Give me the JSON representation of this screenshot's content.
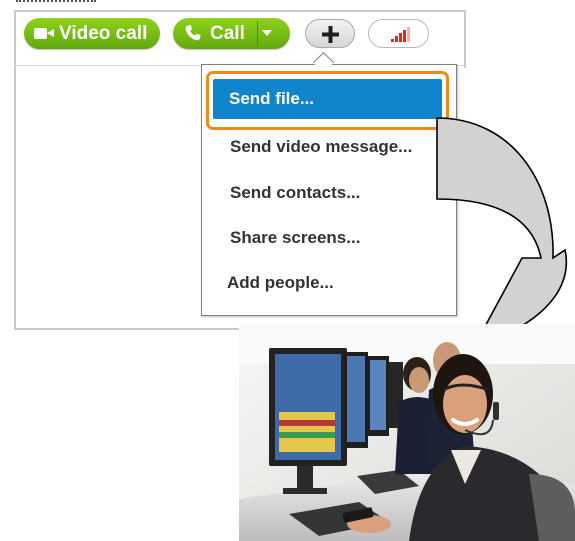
{
  "toolbar": {
    "video_call_label": "Video call",
    "call_label": "Call"
  },
  "menu": {
    "items": [
      "Send file...",
      "Send video message...",
      "Send contacts...",
      "Share screens...",
      "Add people..."
    ],
    "selected_index": 0
  },
  "icons": {
    "video": "video-camera-icon",
    "phone": "phone-icon",
    "dropdown": "chevron-down-icon",
    "add": "plus-icon",
    "signal": "signal-strength-icon",
    "arrow": "curved-arrow-icon"
  },
  "colors": {
    "call_green": "#7cc417",
    "menu_highlight": "#1185cb",
    "focus_ring": "#ef8a1a",
    "signal_red": "#e3271c"
  },
  "signal": {
    "active_bars": 4,
    "total_bars": 5
  }
}
